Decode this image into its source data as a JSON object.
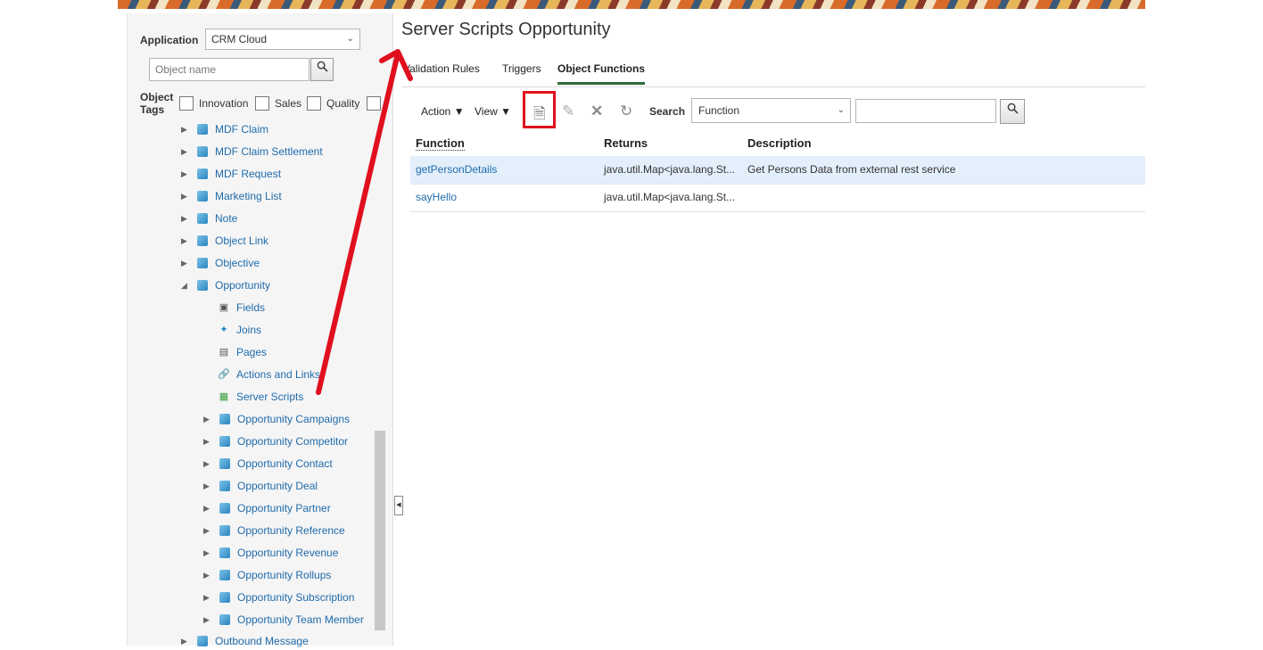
{
  "title": "Server Scripts Opportunity",
  "left": {
    "application_label": "Application",
    "application_value": "CRM Cloud",
    "object_name_placeholder": "Object name",
    "tags_label_line1": "Object",
    "tags_label_line2": "Tags",
    "tags": [
      "Innovation",
      "Sales",
      "Quality"
    ],
    "tree": [
      {
        "label": "MDF Claim"
      },
      {
        "label": "MDF Claim Settlement"
      },
      {
        "label": "MDF Request"
      },
      {
        "label": "Marketing List"
      },
      {
        "label": "Note"
      },
      {
        "label": "Object Link"
      },
      {
        "label": "Objective"
      },
      {
        "label": "Opportunity"
      },
      {
        "label": "Fields"
      },
      {
        "label": "Joins"
      },
      {
        "label": "Pages"
      },
      {
        "label": "Actions and Links"
      },
      {
        "label": "Server Scripts"
      },
      {
        "label": "Opportunity Campaigns"
      },
      {
        "label": "Opportunity Competitor"
      },
      {
        "label": "Opportunity Contact"
      },
      {
        "label": "Opportunity Deal"
      },
      {
        "label": "Opportunity Partner"
      },
      {
        "label": "Opportunity Reference"
      },
      {
        "label": "Opportunity Revenue"
      },
      {
        "label": "Opportunity Rollups"
      },
      {
        "label": "Opportunity Subscription"
      },
      {
        "label": "Opportunity Team Member"
      },
      {
        "label": "Outbound Message"
      }
    ]
  },
  "tabs": [
    "Validation Rules",
    "Triggers",
    "Object Functions"
  ],
  "toolbar": {
    "action_label": "Action",
    "view_label": "View",
    "search_label": "Search",
    "search_field_value": "Function"
  },
  "table": {
    "columns": [
      "Function",
      "Returns",
      "Description"
    ],
    "rows": [
      {
        "function": "getPersonDetails",
        "returns": "java.util.Map<java.lang.St...",
        "description": "Get Persons Data from external rest service"
      },
      {
        "function": "sayHello",
        "returns": "java.util.Map<java.lang.St...",
        "description": ""
      }
    ]
  },
  "colors": {
    "annotation": "#e0101e",
    "link": "#1f6bab",
    "active_tab": "#2e6b3b"
  }
}
